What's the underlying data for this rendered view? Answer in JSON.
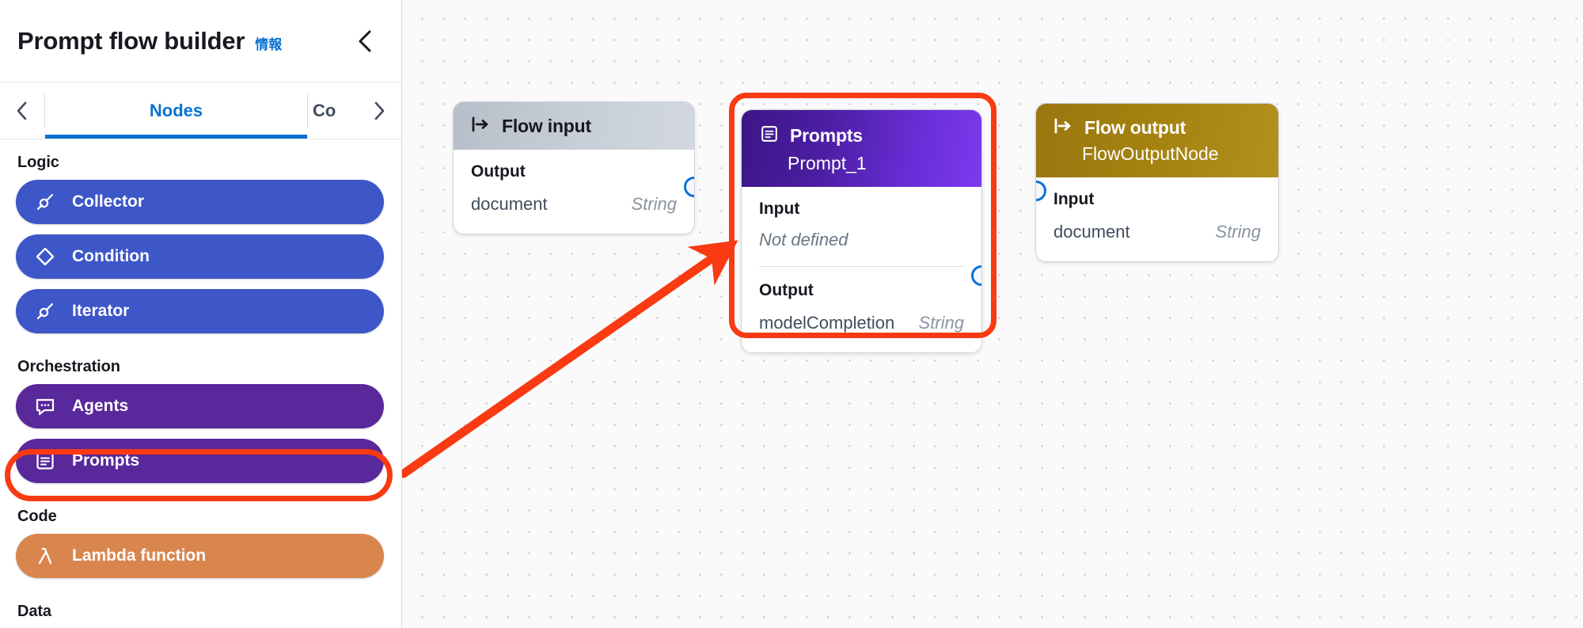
{
  "sidebar": {
    "title": "Prompt flow builder",
    "info_label": "情報",
    "collapse_icon": "chevron-left-icon",
    "tabs": {
      "prev_icon": "chevron-left-icon",
      "next_icon": "chevron-right-icon",
      "items": [
        {
          "label": "Nodes",
          "active": true
        },
        {
          "label": "Co",
          "active": false
        }
      ]
    },
    "groups": [
      {
        "label": "Logic",
        "items": [
          {
            "label": "Collector",
            "icon": "connector-icon",
            "color": "#3d56c8"
          },
          {
            "label": "Condition",
            "icon": "diamond-icon",
            "color": "#3d56c8"
          },
          {
            "label": "Iterator",
            "icon": "connector-icon",
            "color": "#3d56c8"
          }
        ]
      },
      {
        "label": "Orchestration",
        "items": [
          {
            "label": "Agents",
            "icon": "chat-bubble-icon",
            "color": "#59289b"
          },
          {
            "label": "Prompts",
            "icon": "document-lines-icon",
            "color": "#59289b",
            "highlighted": true
          }
        ]
      },
      {
        "label": "Code",
        "items": [
          {
            "label": "Lambda function",
            "icon": "lambda-icon",
            "color": "#d9864e"
          }
        ]
      },
      {
        "label": "Data",
        "items": []
      }
    ]
  },
  "canvas": {
    "nodes": [
      {
        "id": "flow-input",
        "header_title": "Flow input",
        "header_icon": "flow-input-icon",
        "header_subtitle": "",
        "sections": [
          {
            "label": "Output",
            "rows": [
              {
                "name": "document",
                "type": "String"
              }
            ]
          }
        ]
      },
      {
        "id": "prompts",
        "header_title": "Prompts",
        "header_icon": "document-lines-icon",
        "header_subtitle": "Prompt_1",
        "sections": [
          {
            "label": "Input",
            "placeholder": "Not defined",
            "rows": []
          },
          {
            "label": "Output",
            "rows": [
              {
                "name": "modelCompletion",
                "type": "String"
              }
            ]
          }
        ]
      },
      {
        "id": "flow-output",
        "header_title": "Flow output",
        "header_icon": "flow-output-icon",
        "header_subtitle": "FlowOutputNode",
        "sections": [
          {
            "label": "Input",
            "rows": [
              {
                "name": "document",
                "type": "String"
              }
            ]
          }
        ]
      }
    ]
  },
  "annotations": {
    "highlight_color": "#f93a12",
    "arrow_color": "#f93a12",
    "arrow_icon": "arrow-annotation"
  }
}
